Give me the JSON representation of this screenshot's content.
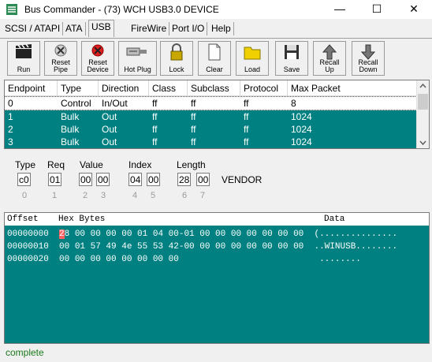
{
  "window": {
    "title": "Bus Commander - (73) WCH USB3.0 DEVICE",
    "minimize": "—",
    "maximize": "☐",
    "close": "✕"
  },
  "tabs": [
    {
      "label": "SCSI / ATAPI",
      "active": false
    },
    {
      "label": "ATA",
      "active": false
    },
    {
      "label": "USB",
      "active": true
    },
    {
      "label": "FireWire",
      "active": false
    },
    {
      "label": "Port I/O",
      "active": false
    },
    {
      "label": "Help",
      "active": false
    }
  ],
  "toolbar": [
    {
      "label1": "Run",
      "label2": "",
      "icon": "clapperboard-icon"
    },
    {
      "label1": "Reset",
      "label2": "Pipe",
      "icon": "reset-pipe-icon"
    },
    {
      "label1": "Reset",
      "label2": "Device",
      "icon": "reset-device-icon"
    },
    {
      "label1": "Hot Plug",
      "label2": "",
      "icon": "usb-plug-icon"
    },
    {
      "label1": "Lock",
      "label2": "",
      "icon": "padlock-icon"
    },
    {
      "label1": "Clear",
      "label2": "",
      "icon": "blank-page-icon"
    },
    {
      "label1": "Load",
      "label2": "",
      "icon": "folder-icon"
    },
    {
      "label1": "Save",
      "label2": "",
      "icon": "floppy-disk-icon"
    },
    {
      "label1": "Recall",
      "label2": "Up",
      "icon": "arrow-up-icon"
    },
    {
      "label1": "Recall",
      "label2": "Down",
      "icon": "arrow-down-icon"
    }
  ],
  "endpoints": {
    "headers": [
      "Endpoint",
      "Type",
      "Direction",
      "Class",
      "Subclass",
      "Protocol",
      "Max Packet"
    ],
    "rows": [
      [
        "0",
        "Control",
        "In/Out",
        "ff",
        "ff",
        "ff",
        "8"
      ],
      [
        "1",
        "Bulk",
        "Out",
        "ff",
        "ff",
        "ff",
        "1024"
      ],
      [
        "2",
        "Bulk",
        "Out",
        "ff",
        "ff",
        "ff",
        "1024"
      ],
      [
        "3",
        "Bulk",
        "Out",
        "ff",
        "ff",
        "ff",
        "1024"
      ]
    ]
  },
  "setup": {
    "labels": {
      "type": "Type",
      "req": "Req",
      "value": "Value",
      "index": "Index",
      "length": "Length"
    },
    "fields": [
      "c0",
      "01",
      "00",
      "00",
      "04",
      "00",
      "28",
      "00"
    ],
    "indices": [
      "0",
      "1",
      "2",
      "3",
      "4",
      "5",
      "6",
      "7"
    ],
    "vendor": "VENDOR"
  },
  "hex": {
    "header_offset": "Offset",
    "header_bytes": "Hex Bytes",
    "header_data": "Data",
    "cursor_char": "2",
    "line0_rest": "8 00 00 00 00 01 04 00-01 00 00 00 00 00 00 00",
    "lines": [
      {
        "offset": "00000000",
        "bytes": "28 00 00 00 00 01 04 00-01 00 00 00 00 00 00 00",
        "ascii": "(..............."
      },
      {
        "offset": "00000010",
        "bytes": "00 01 57 49 4e 55 53 42-00 00 00 00 00 00 00 00",
        "ascii": "..WINUSB........"
      },
      {
        "offset": "00000020",
        "bytes": "00 00 00 00 00 00 00 00",
        "ascii": "........"
      }
    ]
  },
  "status": "complete",
  "colors": {
    "accent": "#008080",
    "status_text": "#1a7a1a"
  }
}
